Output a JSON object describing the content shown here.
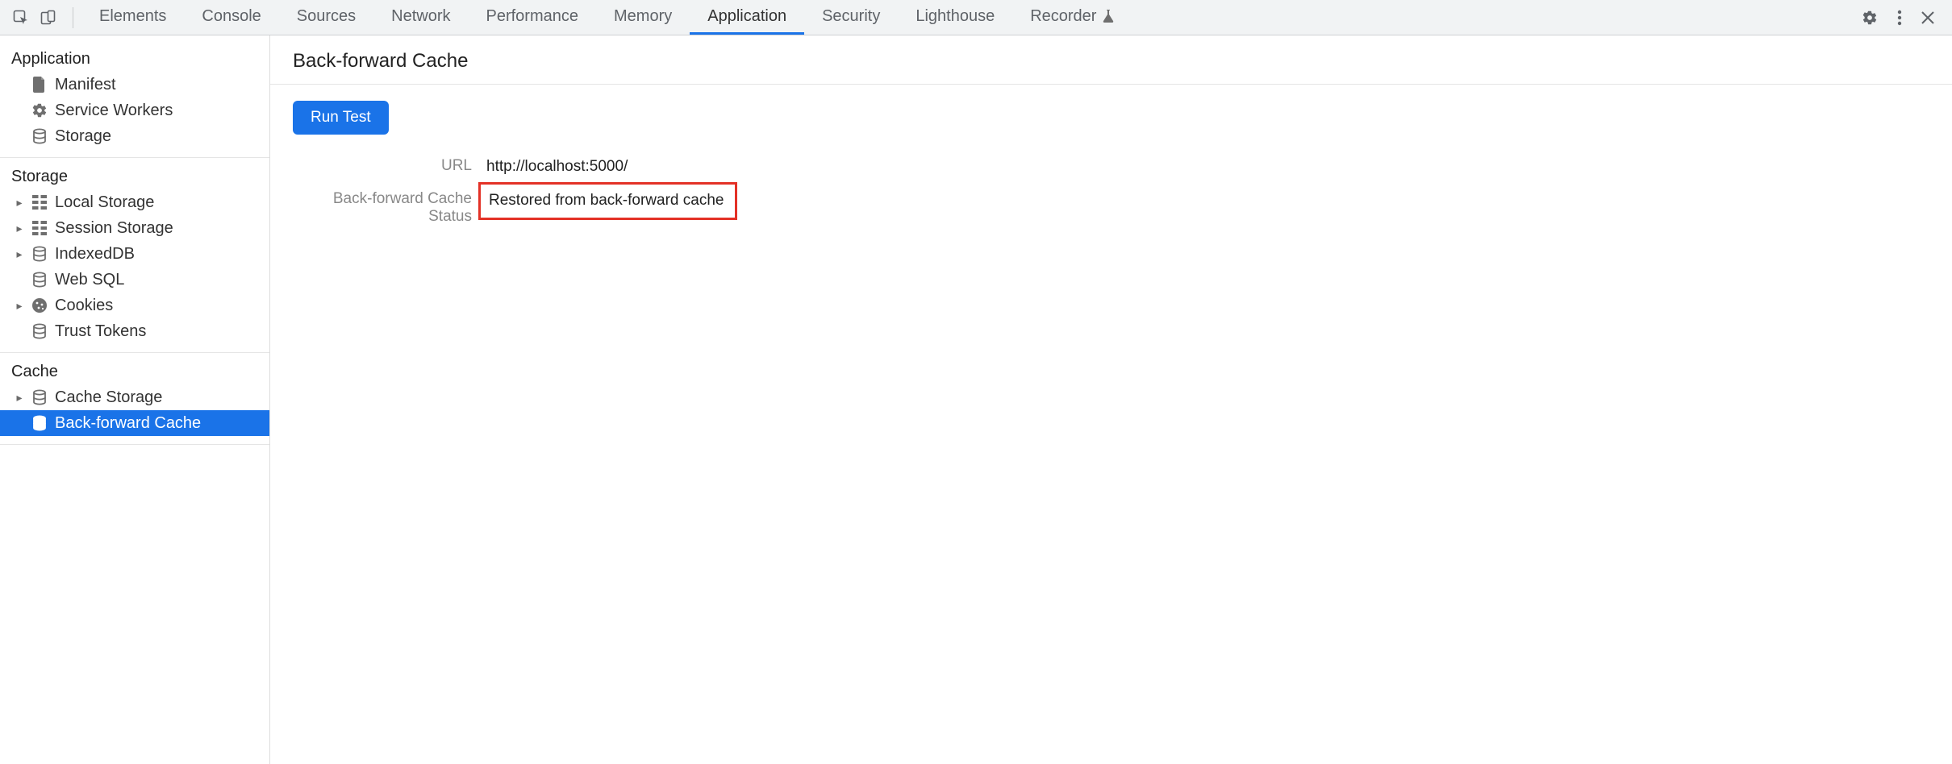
{
  "tabs": [
    "Elements",
    "Console",
    "Sources",
    "Network",
    "Performance",
    "Memory",
    "Application",
    "Security",
    "Lighthouse",
    "Recorder"
  ],
  "active_tab": "Application",
  "sidebar": {
    "sections": [
      {
        "title": "Application",
        "items": [
          {
            "label": "Manifest",
            "icon": "file",
            "expandable": false
          },
          {
            "label": "Service Workers",
            "icon": "gear",
            "expandable": false
          },
          {
            "label": "Storage",
            "icon": "db",
            "expandable": false
          }
        ]
      },
      {
        "title": "Storage",
        "items": [
          {
            "label": "Local Storage",
            "icon": "grid",
            "expandable": true
          },
          {
            "label": "Session Storage",
            "icon": "grid",
            "expandable": true
          },
          {
            "label": "IndexedDB",
            "icon": "db",
            "expandable": true
          },
          {
            "label": "Web SQL",
            "icon": "db",
            "expandable": false
          },
          {
            "label": "Cookies",
            "icon": "cookie",
            "expandable": true
          },
          {
            "label": "Trust Tokens",
            "icon": "db",
            "expandable": false
          }
        ]
      },
      {
        "title": "Cache",
        "items": [
          {
            "label": "Cache Storage",
            "icon": "db",
            "expandable": true
          },
          {
            "label": "Back-forward Cache",
            "icon": "db",
            "expandable": false,
            "selected": true
          }
        ]
      }
    ]
  },
  "content": {
    "title": "Back-forward Cache",
    "run_button": "Run Test",
    "rows": [
      {
        "label": "URL",
        "value": "http://localhost:5000/",
        "highlight": false
      },
      {
        "label": "Back-forward Cache Status",
        "value": "Restored from back-forward cache",
        "highlight": true
      }
    ]
  }
}
